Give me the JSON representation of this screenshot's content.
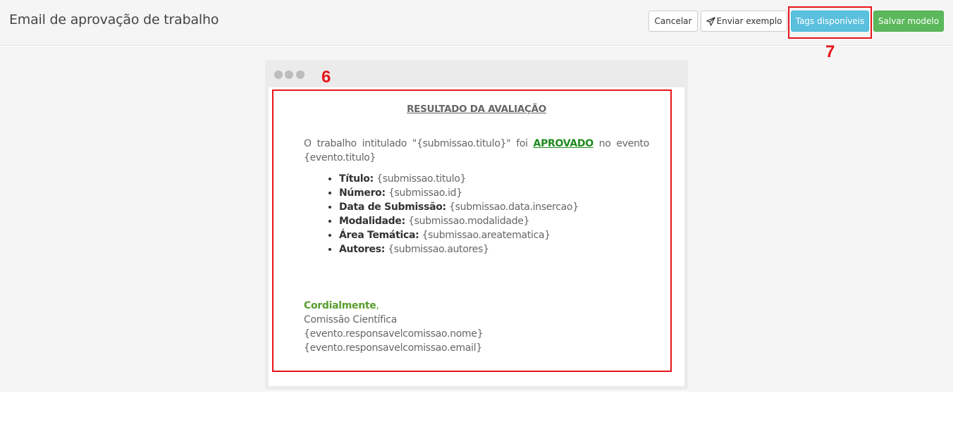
{
  "header": {
    "title": "Email de aprovação de trabalho"
  },
  "toolbar": {
    "cancel_label": "Cancelar",
    "send_label": "Enviar exemplo",
    "tags_label": "Tags disponíveis",
    "save_label": "Salvar modelo"
  },
  "annotations": {
    "content_marker": "6",
    "tags_marker": "7"
  },
  "email": {
    "title": "RESULTADO DA AVALIAÇÃO",
    "intro_before": "O trabalho intitulado \"{submissao.titulo}\" foi ",
    "intro_status": "APROVADO",
    "intro_after": " no evento {evento.titulo}",
    "details": [
      {
        "label": "Título:",
        "value": " {submissao.titulo}"
      },
      {
        "label": "Número:",
        "value": " {submissao.id}"
      },
      {
        "label": "Data de Submissão:",
        "value": " {submissao.data.insercao}"
      },
      {
        "label": "Modalidade:",
        "value": " {submissao.modalidade}"
      },
      {
        "label": "Área Temática:",
        "value": " {submissao.areatematica}"
      },
      {
        "label": "Autores:",
        "value": " {submissao.autores}"
      }
    ],
    "closing_greeting": "Cordialmente",
    "closing_comma": ",",
    "closing_lines": [
      "Comissão Científica",
      "{evento.responsavelcomissao.nome}",
      "{evento.responsavelcomissao.email}"
    ]
  },
  "colors": {
    "highlight": "#e8141b",
    "approved": "#1e8a1e",
    "info_button": "#5bc0de",
    "success_button": "#5cb85c"
  },
  "icons": {
    "send": "paper-plane-icon"
  }
}
